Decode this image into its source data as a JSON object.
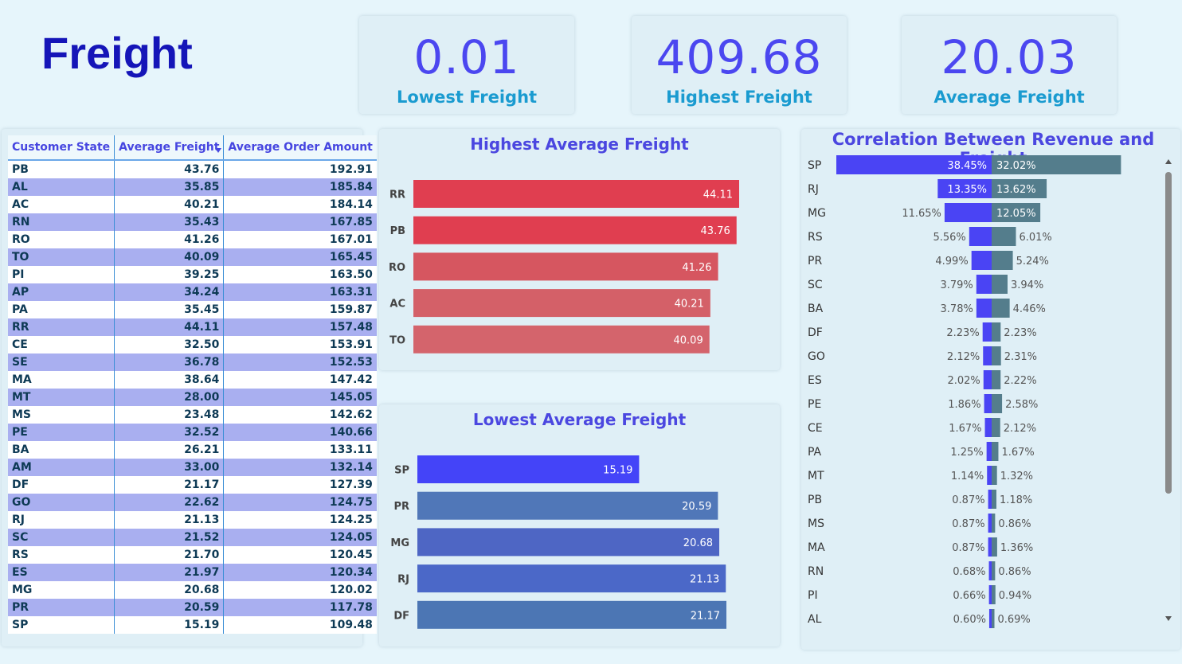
{
  "page_title": "Freight",
  "kpis": [
    {
      "value": "0.01",
      "label": "Lowest Freight"
    },
    {
      "value": "409.68",
      "label": "Highest Freight"
    },
    {
      "value": "20.03",
      "label": "Average Freight"
    }
  ],
  "table": {
    "headers": [
      "Customer State",
      "Average Freight",
      "Average Order Amount"
    ],
    "sorted_column": "Average Order Amount",
    "rows": [
      [
        "PB",
        "43.76",
        "192.91"
      ],
      [
        "AL",
        "35.85",
        "185.84"
      ],
      [
        "AC",
        "40.21",
        "184.14"
      ],
      [
        "RN",
        "35.43",
        "167.85"
      ],
      [
        "RO",
        "41.26",
        "167.01"
      ],
      [
        "TO",
        "40.09",
        "165.45"
      ],
      [
        "PI",
        "39.25",
        "163.50"
      ],
      [
        "AP",
        "34.24",
        "163.31"
      ],
      [
        "PA",
        "35.45",
        "159.87"
      ],
      [
        "RR",
        "44.11",
        "157.48"
      ],
      [
        "CE",
        "32.50",
        "153.91"
      ],
      [
        "SE",
        "36.78",
        "152.53"
      ],
      [
        "MA",
        "38.64",
        "147.42"
      ],
      [
        "MT",
        "28.00",
        "145.05"
      ],
      [
        "MS",
        "23.48",
        "142.62"
      ],
      [
        "PE",
        "32.52",
        "140.66"
      ],
      [
        "BA",
        "26.21",
        "133.11"
      ],
      [
        "AM",
        "33.00",
        "132.14"
      ],
      [
        "DF",
        "21.17",
        "127.39"
      ],
      [
        "GO",
        "22.62",
        "124.75"
      ],
      [
        "RJ",
        "21.13",
        "124.25"
      ],
      [
        "SC",
        "21.52",
        "124.05"
      ],
      [
        "RS",
        "21.70",
        "120.45"
      ],
      [
        "ES",
        "21.97",
        "120.34"
      ],
      [
        "MG",
        "20.68",
        "120.02"
      ],
      [
        "PR",
        "20.59",
        "117.78"
      ],
      [
        "SP",
        "15.19",
        "109.48"
      ]
    ]
  },
  "chart_data": [
    {
      "type": "bar",
      "orientation": "horizontal",
      "title": "Highest Average Freight",
      "categories": [
        "RR",
        "PB",
        "RO",
        "AC",
        "TO"
      ],
      "values": [
        44.11,
        43.76,
        41.26,
        40.21,
        40.09
      ],
      "value_labels": [
        "44.11",
        "43.76",
        "41.26",
        "40.21",
        "40.09"
      ],
      "colors": [
        "#e03e50",
        "#e03e50",
        "#d65660",
        "#d46068",
        "#d4646c"
      ]
    },
    {
      "type": "bar",
      "orientation": "horizontal",
      "title": "Lowest Average Freight",
      "categories": [
        "SP",
        "PR",
        "MG",
        "RJ",
        "DF"
      ],
      "values": [
        15.19,
        20.59,
        20.68,
        21.13,
        21.17
      ],
      "value_labels": [
        "15.19",
        "20.59",
        "20.68",
        "21.13",
        "21.17"
      ],
      "colors": [
        "#4444f8",
        "#5077b8",
        "#4e66c4",
        "#4b68c8",
        "#4c76b4"
      ]
    },
    {
      "type": "bar",
      "orientation": "diverging",
      "title": "Correlation Between Revenue and Freight",
      "categories": [
        "SP",
        "RJ",
        "MG",
        "RS",
        "PR",
        "SC",
        "BA",
        "DF",
        "GO",
        "ES",
        "PE",
        "CE",
        "PA",
        "MT",
        "PB",
        "MS",
        "MA",
        "RN",
        "PI",
        "AL"
      ],
      "series": [
        {
          "values": [
            38.45,
            13.35,
            11.65,
            5.56,
            4.99,
            3.79,
            3.78,
            2.23,
            2.12,
            2.02,
            1.86,
            1.67,
            1.25,
            1.14,
            0.87,
            0.87,
            0.87,
            0.68,
            0.66,
            0.6
          ],
          "labels": [
            "38.45%",
            "13.35%",
            "11.65%",
            "5.56%",
            "4.99%",
            "3.79%",
            "3.78%",
            "2.23%",
            "2.12%",
            "2.02%",
            "1.86%",
            "1.67%",
            "1.25%",
            "1.14%",
            "0.87%",
            "0.87%",
            "0.87%",
            "0.68%",
            "0.66%",
            "0.60%"
          ],
          "color": "#4a44f4"
        },
        {
          "values": [
            32.02,
            13.62,
            12.05,
            6.01,
            5.24,
            3.94,
            4.46,
            2.23,
            2.31,
            2.22,
            2.58,
            2.12,
            1.67,
            1.32,
            1.18,
            0.86,
            1.36,
            0.86,
            0.94,
            0.69
          ],
          "labels": [
            "32.02%",
            "13.62%",
            "12.05%",
            "6.01%",
            "5.24%",
            "3.94%",
            "4.46%",
            "2.23%",
            "2.31%",
            "2.22%",
            "2.58%",
            "2.12%",
            "1.67%",
            "1.32%",
            "1.18%",
            "0.86%",
            "1.36%",
            "0.86%",
            "0.94%",
            "0.69%"
          ],
          "color": "#547d8c"
        }
      ]
    }
  ]
}
